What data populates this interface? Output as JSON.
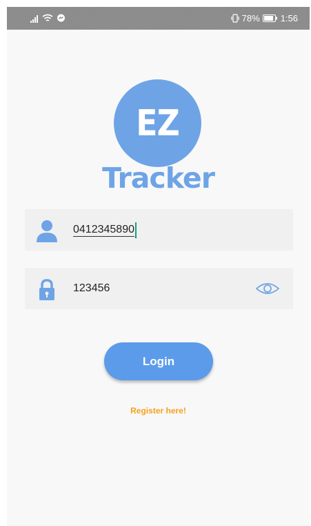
{
  "status_bar": {
    "battery_text": "78%",
    "time": "1:56"
  },
  "logo": {
    "initials": "EZ",
    "word": "Tracker",
    "color": "#6ea4e6"
  },
  "username_field": {
    "icon": "user-icon",
    "value": "0412345890"
  },
  "password_field": {
    "icon": "lock-icon",
    "value": "123456",
    "toggle_icon": "eye-icon"
  },
  "login_button": {
    "label": "Login",
    "color": "#5b9bea"
  },
  "register_link": {
    "label": "Register here!",
    "color": "#f5a11c"
  }
}
